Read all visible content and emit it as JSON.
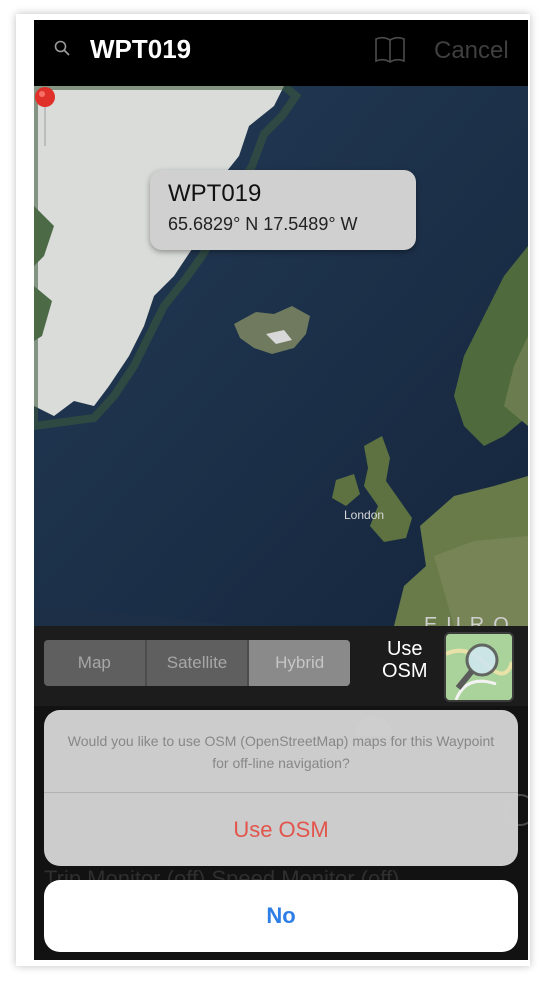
{
  "search": {
    "query": "WPT019",
    "cancel_label": "Cancel"
  },
  "map": {
    "callout": {
      "title": "WPT019",
      "coords": "65.6829° N  17.5489° W"
    },
    "labels": {
      "london": "London",
      "europe": "EURO"
    }
  },
  "controls": {
    "map_types": [
      "Map",
      "Satellite",
      "Hybrid"
    ],
    "selected_map_type": "Hybrid",
    "osm_label_line1": "Use",
    "osm_label_line2": "OSM"
  },
  "background": {
    "row_text": "Trip Monitor (off)  Speed Monitor (off)"
  },
  "action_sheet": {
    "message": "Would you like to use OSM (OpenStreetMap) maps for this Waypoint  for off-line navigation?",
    "primary_label": "Use OSM",
    "cancel_label": "No"
  },
  "colors": {
    "destructive": "#e9584e",
    "accent": "#2d7ee6",
    "pin": "#e0302a"
  }
}
